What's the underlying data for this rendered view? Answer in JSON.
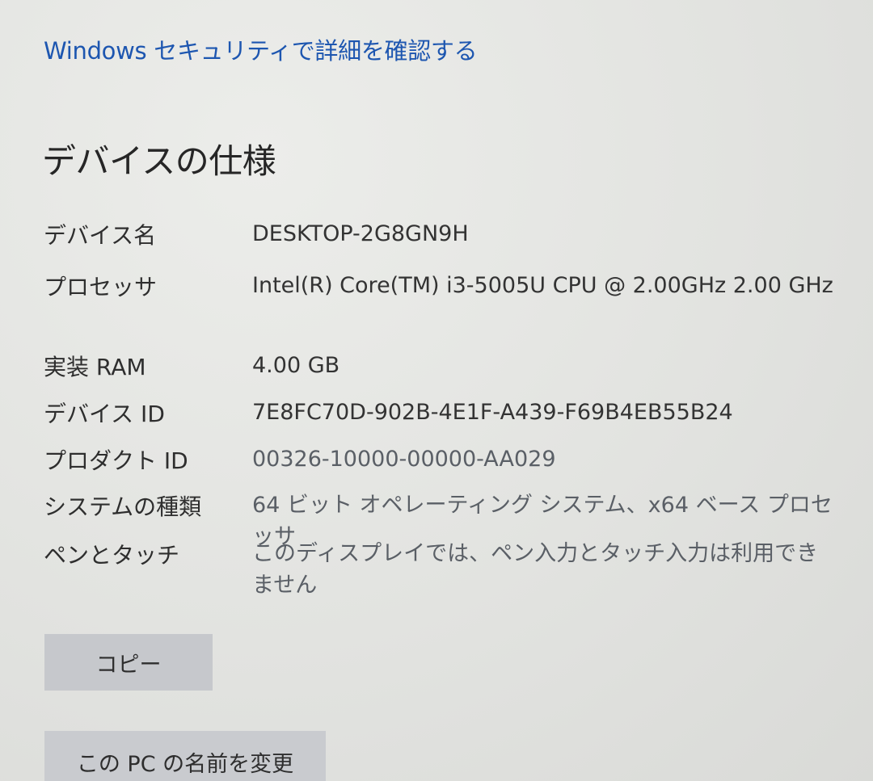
{
  "header": {
    "security_link": "Windows セキュリティで詳細を確認する"
  },
  "device_specs": {
    "title": "デバイスの仕様",
    "rows": [
      {
        "label": "デバイス名",
        "value": "DESKTOP-2G8GN9H"
      },
      {
        "label": "プロセッサ",
        "value": "Intel(R) Core(TM) i3-5005U CPU @ 2.00GHz   2.00 GHz"
      },
      {
        "label": "実装 RAM",
        "value": "4.00 GB"
      },
      {
        "label": "デバイス ID",
        "value": "7E8FC70D-902B-4E1F-A439-F69B4EB55B24"
      },
      {
        "label": "プロダクト ID",
        "value": "00326-10000-00000-AA029"
      },
      {
        "label": "システムの種類",
        "value": "64 ビット オペレーティング システム、x64 ベース プロセッサ"
      },
      {
        "label": "ペンとタッチ",
        "value": "このディスプレイでは、ペン入力とタッチ入力は利用できません"
      }
    ],
    "copy_label": "コピー",
    "rename_label": "この PC の名前を変更"
  },
  "colors": {
    "link": "#1d56b0",
    "background": "#e3e4e1",
    "button": "#c6c8cc"
  }
}
